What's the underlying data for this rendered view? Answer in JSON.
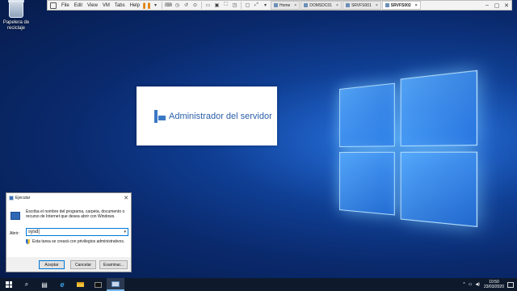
{
  "desktop": {
    "recycle_bin_label": "Papelera de reciclaje"
  },
  "vm_toolbar": {
    "menus": [
      "File",
      "Edit",
      "View",
      "VM",
      "Tabs",
      "Help"
    ],
    "tabs": [
      {
        "label": "Home",
        "active": false
      },
      {
        "label": "DOMSDC01",
        "active": false
      },
      {
        "label": "SRVFS001",
        "active": false
      },
      {
        "label": "SRVFS002",
        "active": true
      }
    ],
    "pause_color": "#e07a00"
  },
  "splash": {
    "title": "Administrador del servidor",
    "accent": "#2a5fa8"
  },
  "run_dialog": {
    "title": "Ejecutar",
    "description": "Escriba el nombre del programa, carpeta, documento o recurso de Internet que desea abrir con Windows.",
    "open_label": "Abrir:",
    "input_value": "sysd|",
    "admin_note": "Esta tarea se creará con privilegios administrativos.",
    "buttons": {
      "ok": "Aceptar",
      "cancel": "Cancelar",
      "browse": "Examinar..."
    },
    "accent": "#0078d7"
  },
  "taskbar": {
    "time": "10:50",
    "date": "23/03/2020",
    "icons": [
      "start-icon",
      "search-icon",
      "task-view-icon",
      "internet-explorer-icon",
      "file-explorer-icon",
      "command-prompt-icon",
      "server-manager-icon"
    ]
  }
}
